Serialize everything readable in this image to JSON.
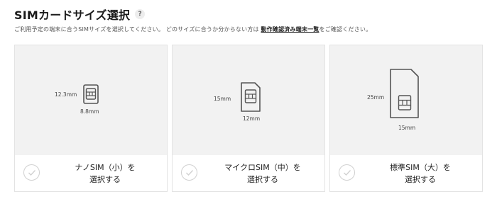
{
  "header": {
    "title": "SIMカードサイズ選択",
    "help_icon": "?"
  },
  "description": {
    "prefix": "ご利用予定の端末に合うSIMサイズを選択してください。 どのサイズに合うか分からない方は ",
    "link": "動作確認済み端末一覧",
    "suffix": "をご確認ください。"
  },
  "cards": [
    {
      "name": "nano",
      "height_label": "12.3mm",
      "width_label": "8.8mm",
      "label_line1": "ナノSIM（小）を",
      "label_line2": "選択する",
      "selected": false,
      "icon": "nano-sim-icon"
    },
    {
      "name": "micro",
      "height_label": "15mm",
      "width_label": "12mm",
      "label_line1": "マイクロSIM（中）を",
      "label_line2": "選択する",
      "selected": false,
      "icon": "micro-sim-icon"
    },
    {
      "name": "standard",
      "height_label": "25mm",
      "width_label": "15mm",
      "label_line1": "標準SIM（大）を",
      "label_line2": "選択する",
      "selected": false,
      "icon": "standard-sim-icon"
    }
  ],
  "colors": {
    "card_bg": "#f2f2f2",
    "border": "#e3e3e3",
    "icon_stroke": "#555555",
    "check": "#d0d0d0"
  }
}
